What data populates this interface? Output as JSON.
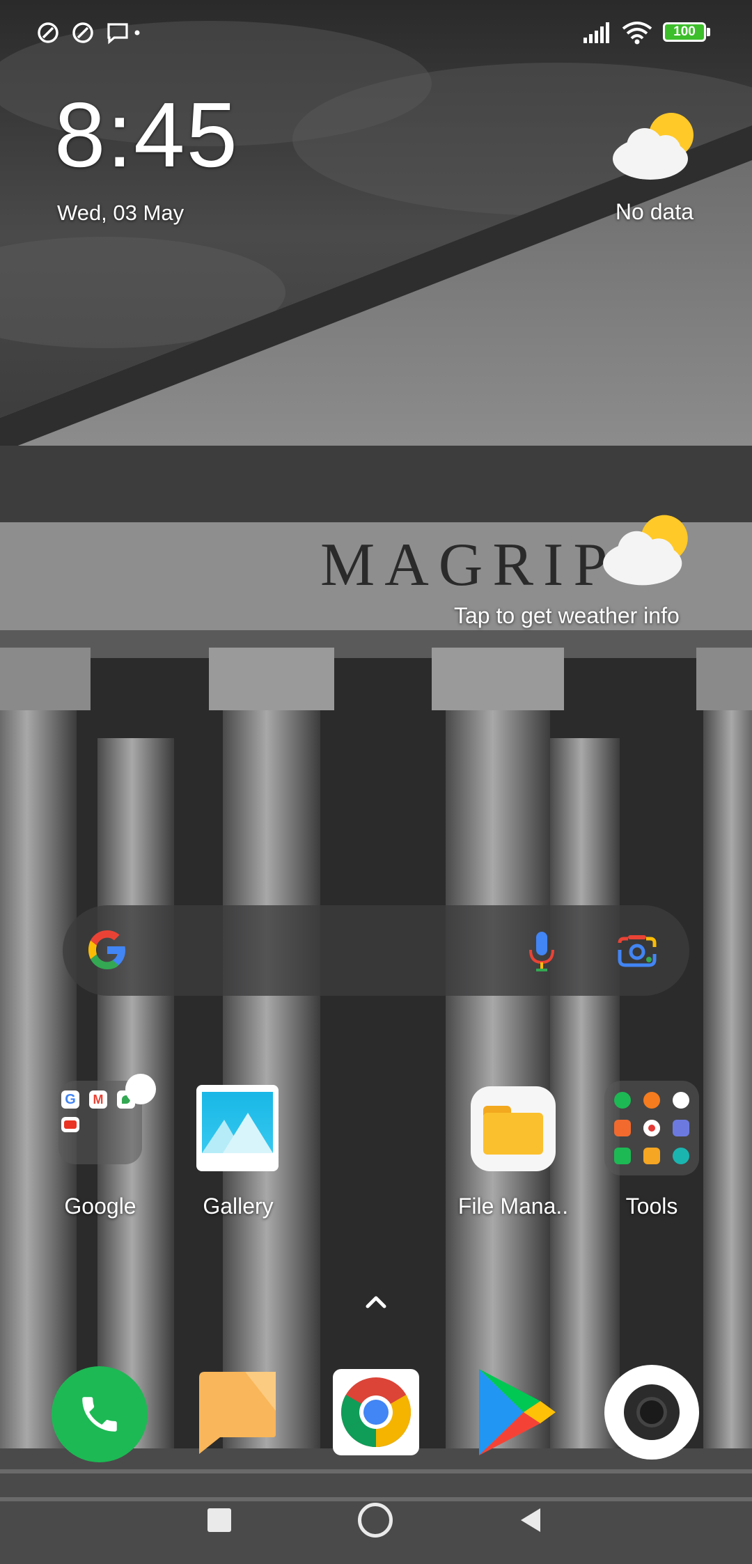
{
  "status_bar": {
    "left_icons": [
      "auto-sync-icon",
      "auto-sync-icon",
      "message-icon",
      "dot-icon"
    ],
    "right_icons": [
      "signal-icon",
      "wifi-icon",
      "battery-icon"
    ],
    "battery_level": "100"
  },
  "clock_widget": {
    "time": "8:45",
    "date": "Wed, 03 May"
  },
  "weather_widget": {
    "status": "No data",
    "icon": "partly-cloudy-icon"
  },
  "weather_widget_2": {
    "hint": "Tap to get weather info",
    "icon": "partly-cloudy-icon"
  },
  "wallpaper_text": "MAGRIP",
  "search_bar": {
    "icons": [
      "google-logo-icon",
      "mic-icon",
      "lens-icon"
    ]
  },
  "home_apps": [
    {
      "label": "Google",
      "icon": "google-folder-icon"
    },
    {
      "label": "Gallery",
      "icon": "gallery-icon"
    },
    {
      "label": "File Mana..",
      "icon": "file-manager-icon"
    },
    {
      "label": "Tools",
      "icon": "tools-folder-icon"
    }
  ],
  "dock_apps": [
    {
      "name": "Phone",
      "icon": "phone-icon"
    },
    {
      "name": "Messaging",
      "icon": "messaging-icon"
    },
    {
      "name": "Chrome",
      "icon": "chrome-icon"
    },
    {
      "name": "Play Store",
      "icon": "play-store-icon"
    },
    {
      "name": "Camera",
      "icon": "camera-icon"
    }
  ],
  "nav_bar": {
    "buttons": [
      "recents-button",
      "home-button",
      "back-button"
    ]
  },
  "colors": {
    "phone_green": "#1DB954",
    "battery_green": "#3DBE2B",
    "folder_yellow": "#FBC02D",
    "message_orange": "#F9B65A"
  }
}
